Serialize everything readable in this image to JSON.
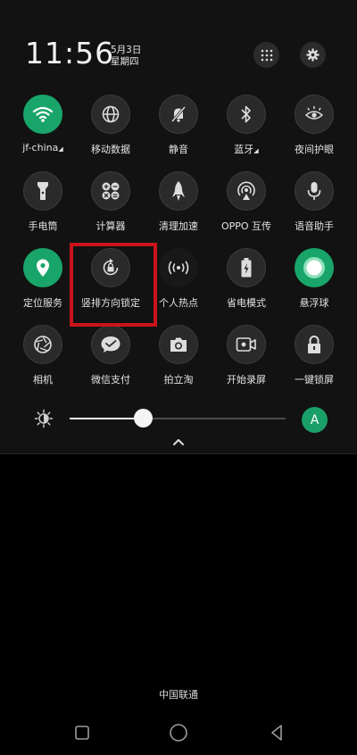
{
  "status": {
    "time": "11:56",
    "date": "5月3日",
    "weekday": "星期四"
  },
  "header_buttons": [
    {
      "icon": "grid-icon"
    },
    {
      "icon": "gear-icon"
    }
  ],
  "tiles": [
    {
      "label": "jf-china",
      "icon": "wifi-icon",
      "active": true,
      "expand": true
    },
    {
      "label": "移动数据",
      "icon": "globe-icon",
      "active": false
    },
    {
      "label": "静音",
      "icon": "bell-off-icon",
      "active": false
    },
    {
      "label": "蓝牙",
      "icon": "bluetooth-icon",
      "active": false,
      "expand": true
    },
    {
      "label": "夜间护眼",
      "icon": "eye-icon",
      "active": false
    },
    {
      "label": "手电筒",
      "icon": "flashlight-icon",
      "active": false
    },
    {
      "label": "计算器",
      "icon": "calculator-icon",
      "active": false
    },
    {
      "label": "清理加速",
      "icon": "rocket-icon",
      "active": false
    },
    {
      "label": "OPPO 互传",
      "icon": "share-icon",
      "active": false
    },
    {
      "label": "语音助手",
      "icon": "microphone-icon",
      "active": false
    },
    {
      "label": "定位服务",
      "icon": "location-icon",
      "active": true
    },
    {
      "label": "竖排方向锁定",
      "icon": "rotation-lock-icon",
      "active": false
    },
    {
      "label": "个人热点",
      "icon": "hotspot-icon",
      "active": false
    },
    {
      "label": "省电模式",
      "icon": "battery-icon",
      "active": false
    },
    {
      "label": "悬浮球",
      "icon": "floating-ball-icon",
      "active": true
    },
    {
      "label": "相机",
      "icon": "camera-shutter-icon",
      "active": false
    },
    {
      "label": "微信支付",
      "icon": "wechat-pay-icon",
      "active": false
    },
    {
      "label": "拍立淘",
      "icon": "camera-icon",
      "active": false
    },
    {
      "label": "开始录屏",
      "icon": "screen-record-icon",
      "active": false
    },
    {
      "label": "一键锁屏",
      "icon": "lock-icon",
      "active": false
    }
  ],
  "brightness": {
    "level": 0.34,
    "auto_label": "A",
    "icon": "brightness-icon"
  },
  "collapse_icon": "chevron-up-icon",
  "carrier": "中国联通",
  "nav": [
    "square-icon",
    "circle-icon",
    "triangle-back-icon"
  ],
  "colors": {
    "accent": "#19a56a",
    "highlight": "#c8141c"
  }
}
